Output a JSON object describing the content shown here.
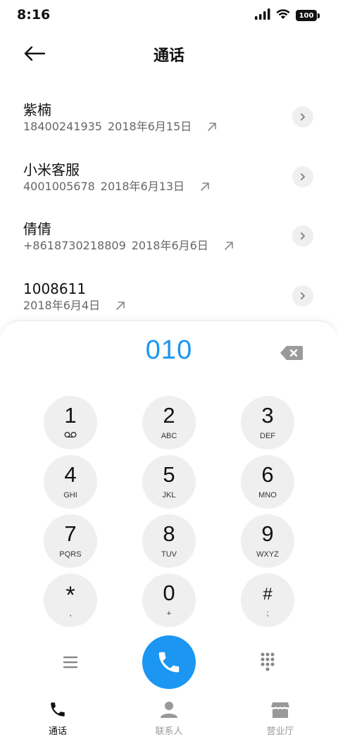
{
  "status": {
    "time": "8:16",
    "battery": "100"
  },
  "header": {
    "title": "通话"
  },
  "call_history": [
    {
      "name": "紫楠",
      "number": "18400241935",
      "date": "2018年6月15日"
    },
    {
      "name": "小米客服",
      "number": "4001005678",
      "date": "2018年6月13日"
    },
    {
      "name": "倩倩",
      "number": "+8618730218809",
      "date": "2018年6月6日"
    },
    {
      "name": "1008611",
      "number": "",
      "date": "2018年6月4日"
    }
  ],
  "dialer": {
    "entered_number": "010",
    "keys": [
      {
        "digit": "1",
        "letters": ""
      },
      {
        "digit": "2",
        "letters": "ABC"
      },
      {
        "digit": "3",
        "letters": "DEF"
      },
      {
        "digit": "4",
        "letters": "GHI"
      },
      {
        "digit": "5",
        "letters": "JKL"
      },
      {
        "digit": "6",
        "letters": "MNO"
      },
      {
        "digit": "7",
        "letters": "PQRS"
      },
      {
        "digit": "8",
        "letters": "TUV"
      },
      {
        "digit": "9",
        "letters": "WXYZ"
      },
      {
        "digit": "*",
        "letters": ","
      },
      {
        "digit": "0",
        "letters": "+"
      },
      {
        "digit": "#",
        "letters": ";"
      }
    ]
  },
  "bottom_nav": {
    "items": [
      {
        "label": "通话",
        "icon": "phone-icon",
        "active": true
      },
      {
        "label": "联系人",
        "icon": "person-icon",
        "active": false
      },
      {
        "label": "营业厅",
        "icon": "store-icon",
        "active": false
      }
    ]
  },
  "colors": {
    "accent": "#1b96f2",
    "key_bg": "#efefef",
    "text_primary": "#111111",
    "text_secondary": "#666666",
    "nav_inactive": "#999999"
  }
}
